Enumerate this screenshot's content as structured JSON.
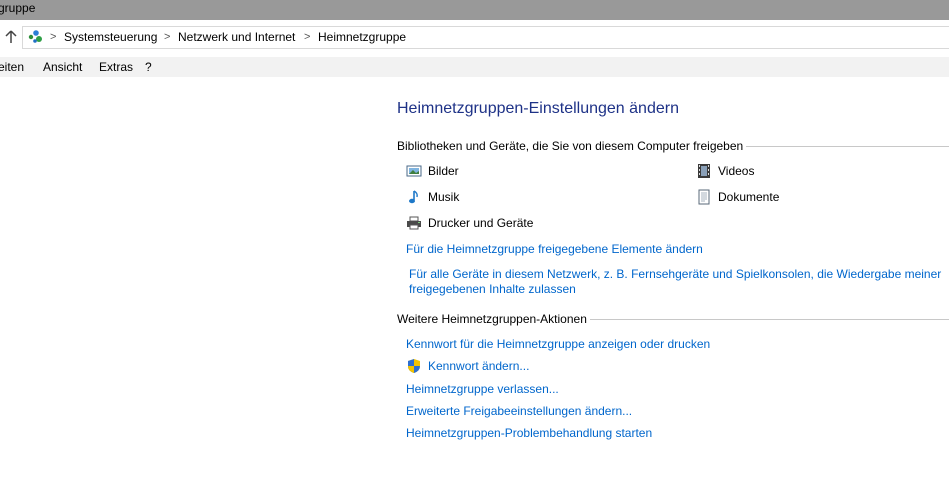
{
  "window": {
    "title": "gruppe"
  },
  "address": {
    "crumbs": [
      "Systemsteuerung",
      "Netzwerk und Internet",
      "Heimnetzgruppe"
    ],
    "separator": ">"
  },
  "menu": {
    "items": [
      "eiten",
      "Ansicht",
      "Extras",
      "?"
    ]
  },
  "main": {
    "heading": "Heimnetzgruppen-Einstellungen ändern",
    "libraries": {
      "title": "Bibliotheken und Geräte, die Sie von diesem Computer freigeben",
      "items": [
        {
          "label": "Bilder",
          "icon": "pictures-icon"
        },
        {
          "label": "Videos",
          "icon": "videos-icon"
        },
        {
          "label": "Musik",
          "icon": "music-icon"
        },
        {
          "label": "Dokumente",
          "icon": "documents-icon"
        },
        {
          "label": "Drucker und Geräte",
          "icon": "printer-icon"
        }
      ],
      "link_change": "Für die Heimnetzgruppe freigegebene Elemente ändern",
      "link_stream_1": "Für alle Geräte in diesem Netzwerk, z. B. Fernsehgeräte und Spielkonsolen, die Wiedergabe meiner",
      "link_stream_2": "freigegebenen Inhalte zulassen"
    },
    "actions": {
      "title": "Weitere Heimnetzgruppen-Aktionen",
      "links": [
        "Kennwort für die Heimnetzgruppe anzeigen oder drucken",
        "Kennwort ändern...",
        "Heimnetzgruppe verlassen...",
        "Erweiterte Freigabeeinstellungen ändern...",
        "Heimnetzgruppen-Problembehandlung starten"
      ]
    }
  }
}
